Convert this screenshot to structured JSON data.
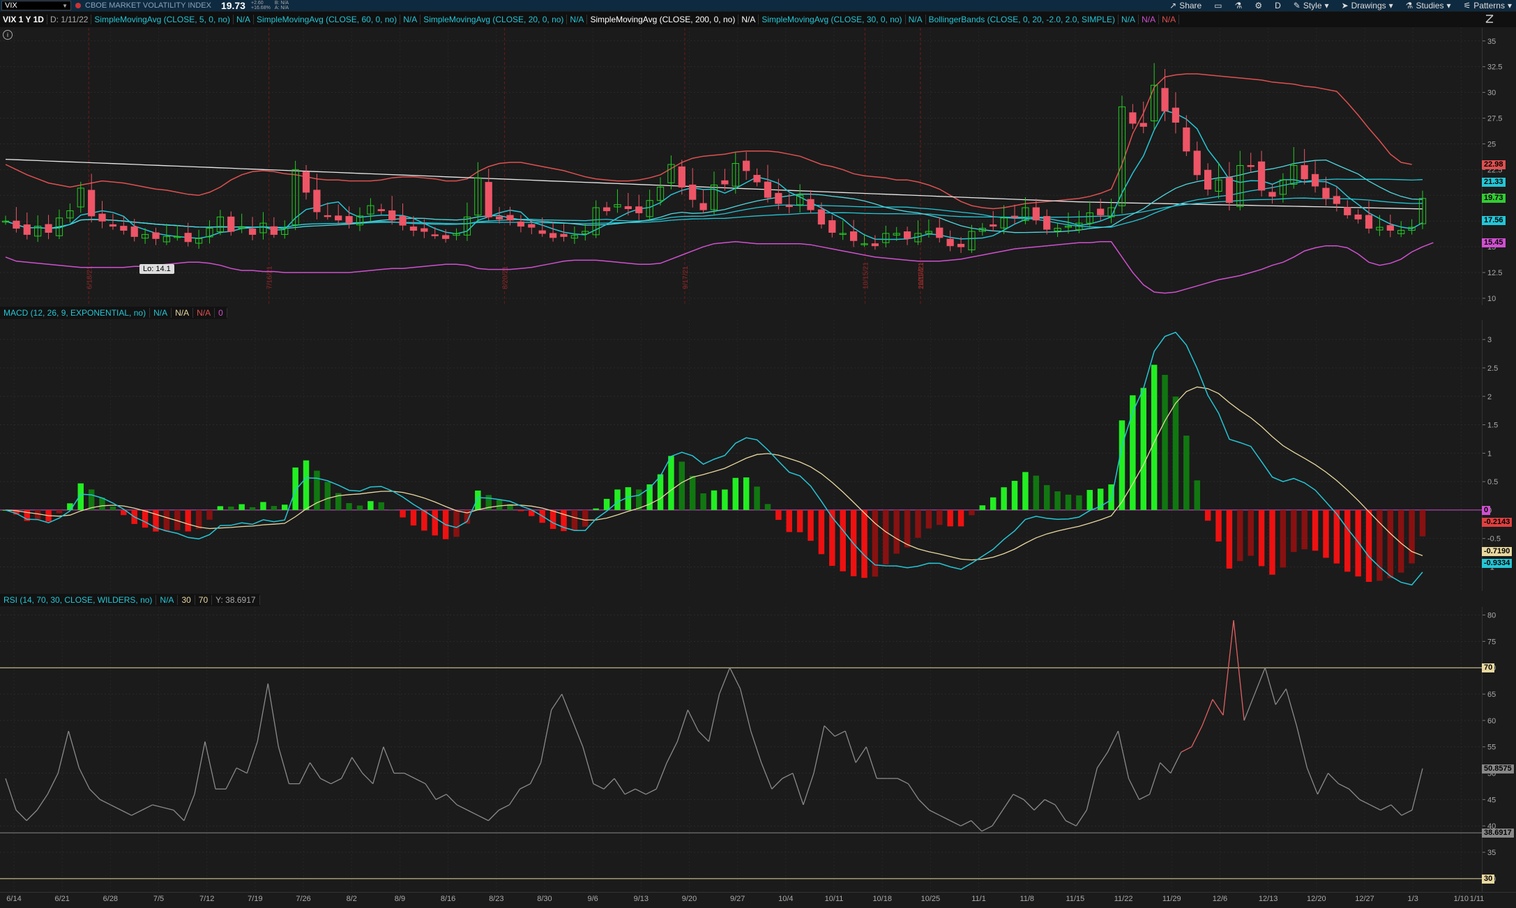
{
  "header": {
    "symbol": "VIX",
    "description": "CBOE MARKET VOLATILITY INDEX",
    "last": "19.73",
    "change": "+2.60",
    "change_pct": "+16.68%",
    "bid": "B: N/A",
    "ask": "A: N/A",
    "toolbar": {
      "share": "Share",
      "style": "Style",
      "drawings": "Drawings",
      "studies": "Studies",
      "patterns": "Patterns",
      "period": "D"
    }
  },
  "studybar": {
    "aggregation": "VIX 1 Y 1D",
    "date": "D: 1/11/22",
    "studies": [
      "SimpleMovingAvg (CLOSE, 5, 0, no)",
      "N/A",
      "SimpleMovingAvg (CLOSE, 60, 0, no)",
      "N/A",
      "SimpleMovingAvg (CLOSE, 20, 0, no)",
      "N/A",
      "SimpleMovingAvg (CLOSE, 200, 0, no)",
      "N/A",
      "SimpleMovingAvg (CLOSE, 30, 0, no)",
      "N/A",
      "BollingerBands (CLOSE, 0, 20, -2.0, 2.0, SIMPLE)",
      "N/A",
      "N/A",
      "N/A"
    ]
  },
  "price_pane": {
    "low_label": "Lo: 14.1",
    "y_ticks": [
      "35",
      "32.5",
      "30",
      "27.5",
      "25",
      "22.5",
      "20",
      "17.5",
      "15",
      "12.5",
      "10"
    ],
    "tags": [
      {
        "text": "22.98",
        "color": "#e05050"
      },
      {
        "text": "21.33",
        "color": "#24c6d6"
      },
      {
        "text": "19.73",
        "color": "#33cc33"
      },
      {
        "text": "17.56",
        "color": "#24c6d6"
      },
      {
        "text": "15.45",
        "color": "#d050d0"
      }
    ],
    "event_labels": [
      "6/18/21",
      "7/16/21",
      "8/20/21",
      "9/17/21",
      "10/15/21",
      "11/19/21",
      "12/17/21",
      "2021 1..."
    ]
  },
  "macd_pane": {
    "title": "MACD (12, 26, 9, EXPONENTIAL, no)",
    "v1": "N/A",
    "v2": "N/A",
    "v3": "N/A",
    "v4": "0",
    "y_ticks": [
      "3",
      "2.5",
      "2",
      "1.5",
      "1",
      "0.5",
      "0",
      "-0.5",
      "-1"
    ],
    "tags": [
      {
        "text": "0",
        "color": "#d050d0"
      },
      {
        "text": "-0.2143",
        "color": "#e04040"
      },
      {
        "text": "-0.7190",
        "color": "#e8d8a0"
      },
      {
        "text": "-0.9334",
        "color": "#24c6d6"
      }
    ]
  },
  "rsi_pane": {
    "title": "RSI (14, 70, 30, CLOSE, WILDERS, no)",
    "v1": "N/A",
    "v2": "30",
    "v3": "70",
    "v4": "Y: 38.6917",
    "y_ticks": [
      "80",
      "75",
      "70",
      "65",
      "60",
      "55",
      "50",
      "45",
      "40",
      "35",
      "30"
    ],
    "tags": [
      {
        "text": "70",
        "color": "#e8d8a0"
      },
      {
        "text": "50.8575",
        "color": "#888888"
      },
      {
        "text": "38.6917",
        "color": "#888888"
      },
      {
        "text": "30",
        "color": "#e8d8a0"
      }
    ]
  },
  "dates": [
    "6/14",
    "6/21",
    "6/28",
    "7/5",
    "7/12",
    "7/19",
    "7/26",
    "8/2",
    "8/9",
    "8/16",
    "8/23",
    "8/30",
    "9/6",
    "9/13",
    "9/20",
    "9/27",
    "10/4",
    "10/11",
    "10/18",
    "10/25",
    "11/1",
    "11/8",
    "11/15",
    "11/22",
    "11/29",
    "12/6",
    "12/13",
    "12/20",
    "12/27",
    "1/3",
    "1/10",
    "1/11"
  ],
  "chart_data": [
    {
      "type": "candlestick",
      "title": "VIX 1 Y 1D",
      "ylim": [
        10,
        36
      ],
      "close": [
        17.5,
        16.8,
        16.2,
        17.0,
        16.4,
        17.8,
        18.5,
        20.7,
        18.0,
        17.5,
        17.0,
        16.6,
        16.0,
        16.2,
        15.8,
        16.0,
        16.0,
        15.5,
        15.8,
        16.8,
        17.9,
        16.5,
        16.9,
        16.2,
        17.3,
        16.2,
        16.8,
        22.5,
        20.3,
        18.4,
        18.0,
        17.6,
        17.3,
        18.0,
        19.0,
        18.5,
        17.6,
        17.1,
        16.6,
        16.5,
        16.1,
        15.8,
        16.3,
        17.9,
        21.7,
        17.9,
        17.7,
        17.6,
        17.0,
        16.9,
        16.3,
        15.9,
        16.0,
        16.1,
        16.5,
        18.8,
        18.5,
        19.1,
        18.7,
        18.3,
        19.5,
        20.8,
        23.0,
        20.8,
        19.6,
        18.6,
        21.0,
        21.1,
        23.1,
        22.4,
        21.3,
        19.8,
        19.2,
        18.9,
        20.0,
        18.6,
        17.2,
        16.4,
        16.3,
        15.6,
        15.3,
        15.1,
        16.3,
        16.3,
        15.8,
        16.3,
        16.5,
        15.9,
        15.1,
        15.0,
        16.5,
        16.8,
        17.0,
        17.8,
        17.9,
        18.8,
        17.6,
        16.7,
        16.8,
        17.0,
        17.3,
        18.3,
        18.1,
        18.8,
        28.6,
        27.0,
        26.7,
        30.7,
        28.2,
        27.1,
        24.3,
        22.0,
        20.6,
        21.5,
        19.3,
        22.9,
        22.8,
        20.5,
        19.9,
        21.5,
        22.9,
        21.6,
        20.9,
        19.7,
        19.2,
        18.1,
        17.7,
        16.8,
        16.9,
        16.6,
        16.6,
        16.9,
        19.7
      ],
      "bb_upper": [
        23,
        22.5,
        22,
        21.6,
        21.2,
        21,
        20.8,
        21,
        21.2,
        21.4,
        21.3,
        21.2,
        21,
        20.8,
        20.6,
        20.5,
        20.3,
        20.1,
        20,
        20.3,
        20.8,
        21.5,
        22,
        22.3,
        22.4,
        22.3,
        22.1,
        22.0,
        21.8,
        21.6,
        21.5,
        21.5,
        21.4,
        21.4,
        21.4,
        21.5,
        21.7,
        21.8,
        21.8,
        21.7,
        21.6,
        21.4,
        21.4,
        21.6,
        22.3,
        22.8,
        23.1,
        23.2,
        23.2,
        23.0,
        22.8,
        22.6,
        22.4,
        22.1,
        21.8,
        21.6,
        21.5,
        21.4,
        21.4,
        21.5,
        21.7,
        22.0,
        22.6,
        23.2,
        23.6,
        23.8,
        23.9,
        24.0,
        24.2,
        24.3,
        24.3,
        24.3,
        24.2,
        24.0,
        23.8,
        23.4,
        23.0,
        22.8,
        22.5,
        22.1,
        21.9,
        21.8,
        21.7,
        21.5,
        21.5,
        21.3,
        21.0,
        20.6,
        20.0,
        19.4,
        19.0,
        18.8,
        18.7,
        18.8,
        19.0,
        19.2,
        19.3,
        19.4,
        19.5,
        19.6,
        19.7,
        19.9,
        20.2,
        20.6,
        23.0,
        26.0,
        28.0,
        30.5,
        31.5,
        31.7,
        31.8,
        31.8,
        31.7,
        31.6,
        31.5,
        31.4,
        31.3,
        31.2,
        31.0,
        30.9,
        30.8,
        30.6,
        30.5,
        30.3,
        30.1,
        29.0,
        27.8,
        26.5,
        25.3,
        24.0,
        23.2,
        23.0
      ],
      "bb_lower": [
        14.0,
        13.6,
        13.5,
        13.4,
        13.3,
        13.2,
        13.1,
        13.0,
        13.0,
        13.0,
        13.0,
        13.0,
        13.1,
        13.1,
        13.2,
        13.3,
        13.4,
        13.5,
        13.5,
        13.4,
        13.2,
        12.9,
        12.7,
        12.7,
        12.6,
        12.6,
        12.5,
        12.5,
        12.5,
        12.5,
        12.5,
        12.5,
        12.5,
        12.6,
        12.7,
        12.8,
        12.9,
        12.9,
        13.0,
        13.1,
        13.2,
        13.3,
        13.3,
        13.2,
        12.9,
        12.8,
        12.8,
        12.8,
        12.9,
        13.0,
        13.2,
        13.4,
        13.6,
        13.7,
        13.7,
        13.7,
        13.6,
        13.5,
        13.4,
        13.3,
        13.3,
        13.4,
        13.8,
        14.2,
        14.6,
        15.0,
        15.3,
        15.4,
        15.5,
        15.4,
        15.3,
        15.3,
        15.3,
        15.3,
        15.3,
        15.2,
        15.0,
        14.8,
        14.6,
        14.4,
        14.2,
        14.0,
        13.9,
        13.8,
        13.7,
        13.6,
        13.6,
        13.6,
        13.7,
        13.8,
        14.0,
        14.2,
        14.4,
        14.6,
        14.8,
        14.9,
        15.0,
        15.1,
        15.2,
        15.3,
        15.4,
        15.4,
        15.5,
        15.5,
        14.0,
        12.5,
        11.3,
        10.6,
        10.5,
        10.6,
        10.9,
        11.2,
        11.5,
        11.8,
        12.0,
        12.2,
        12.5,
        12.8,
        13.2,
        13.5,
        14.0,
        14.6,
        14.9,
        15.1,
        15.1,
        14.9,
        14.3,
        13.5,
        13.2,
        13.4,
        13.8,
        14.5,
        15.0,
        15.4
      ]
    },
    {
      "type": "line",
      "title": "MACD (12, 26, 9, EXPONENTIAL, no)",
      "ylim": [
        -1.3,
        3.1
      ]
    },
    {
      "type": "line",
      "title": "RSI (14, 70, 30, CLOSE, WILDERS, no)",
      "ylim": [
        28,
        81
      ],
      "values": [
        49,
        43,
        41,
        43,
        46,
        50,
        58,
        51,
        47,
        45,
        44,
        43,
        42,
        43,
        44,
        43.5,
        43,
        41,
        46,
        56,
        47,
        47,
        51,
        50,
        56,
        67,
        55,
        48,
        48,
        52,
        49,
        48,
        49,
        53,
        50,
        48,
        55,
        50,
        50,
        49,
        48,
        45,
        46,
        44,
        43,
        42,
        41,
        43,
        44,
        47,
        48,
        52,
        62,
        65,
        60,
        55,
        48,
        47,
        49,
        46,
        47,
        46,
        47,
        52,
        56,
        62,
        58,
        56,
        65,
        70,
        66,
        58,
        52,
        47,
        49,
        50,
        44,
        50,
        59,
        57,
        58,
        52,
        55,
        49,
        49,
        49,
        48,
        45,
        43,
        42,
        41,
        40,
        41,
        39,
        40,
        43,
        46,
        45,
        43,
        45,
        44,
        41,
        40,
        43,
        51,
        54,
        58,
        49,
        45,
        46,
        52,
        50,
        54,
        55,
        59,
        64,
        61,
        79,
        60,
        65,
        70,
        63,
        66,
        59,
        51,
        46,
        50,
        48,
        47,
        45,
        44,
        43,
        44,
        42,
        43,
        50.9
      ]
    }
  ]
}
